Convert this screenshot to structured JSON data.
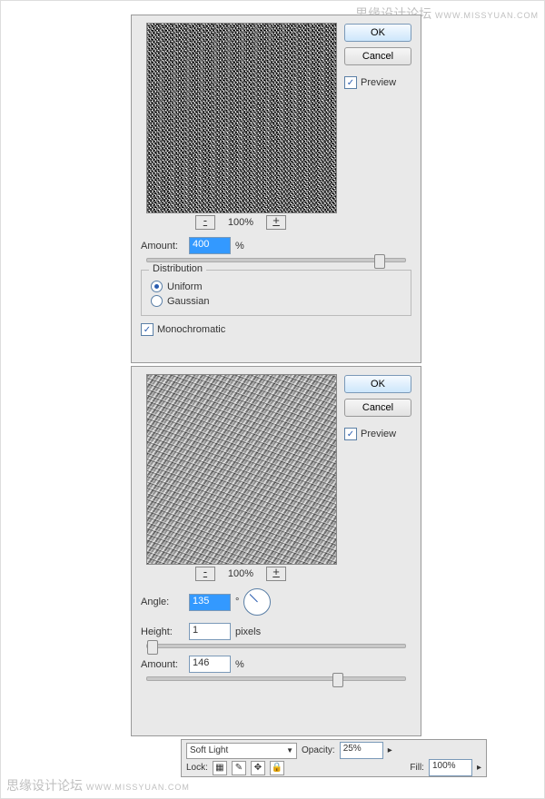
{
  "watermark": {
    "cn": "思缘设计论坛",
    "en": "WWW.MISSYUAN.COM"
  },
  "dialog_noise": {
    "ok": "OK",
    "cancel": "Cancel",
    "preview_chk": "Preview",
    "zoom": "100%",
    "amount_label": "Amount:",
    "amount_value": "400",
    "amount_unit": "%",
    "distribution_legend": "Distribution",
    "uniform": "Uniform",
    "gaussian": "Gaussian",
    "monochromatic": "Monochromatic"
  },
  "dialog_emboss": {
    "ok": "OK",
    "cancel": "Cancel",
    "preview_chk": "Preview",
    "zoom": "100%",
    "angle_label": "Angle:",
    "angle_value": "135",
    "angle_unit": "°",
    "height_label": "Height:",
    "height_value": "1",
    "height_unit": "pixels",
    "amount_label": "Amount:",
    "amount_value": "146",
    "amount_unit": "%"
  },
  "layer_panel": {
    "blend_mode": "Soft Light",
    "opacity_label": "Opacity:",
    "opacity_value": "25%",
    "lock_label": "Lock:",
    "fill_label": "Fill:",
    "fill_value": "100%"
  }
}
